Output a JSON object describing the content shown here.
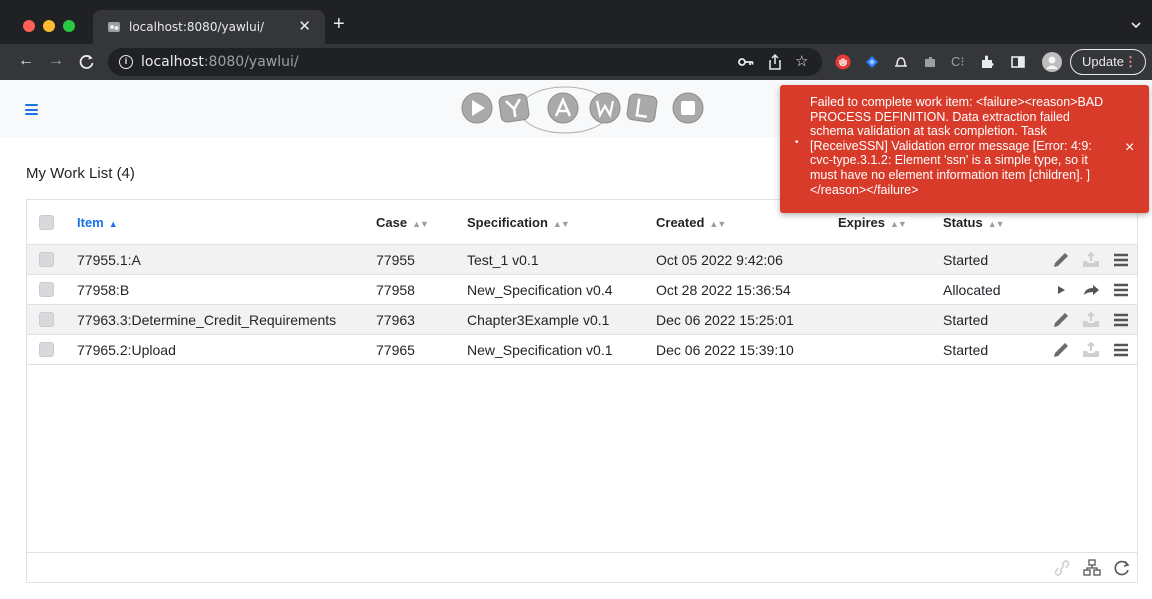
{
  "browser": {
    "tab_title": "localhost:8080/yawlui/",
    "url_host": "localhost",
    "url_rest": ":8080/yawlui/",
    "update_label": "Update"
  },
  "worklist": {
    "title": "My Work List (4)",
    "columns": [
      "Item",
      "Case",
      "Specification",
      "Created",
      "Expires",
      "Status"
    ],
    "sort_column": "Item",
    "rows": [
      {
        "item": "77955.1:A",
        "case": "77955",
        "spec": "Test_1 v0.1",
        "created": "Oct 05 2022 9:42:06",
        "expires": "",
        "status": "Started"
      },
      {
        "item": "77958:B",
        "case": "77958",
        "spec": "New_Specification v0.4",
        "created": "Oct 28 2022 15:36:54",
        "expires": "",
        "status": "Allocated"
      },
      {
        "item": "77963.3:Determine_Credit_Requirements",
        "case": "77963",
        "spec": "Chapter3Example v0.1",
        "created": "Dec 06 2022 15:25:01",
        "expires": "",
        "status": "Started"
      },
      {
        "item": "77965.2:Upload",
        "case": "77965",
        "spec": "New_Specification v0.1",
        "created": "Dec 06 2022 15:39:10",
        "expires": "",
        "status": "Started"
      }
    ]
  },
  "toast": {
    "message": "Failed to complete work item: <failure><reason>BAD PROCESS DEFINITION. Data extraction failed schema validation at task completion. Task [ReceiveSSN] Validation error message [Error: 4:9: cvc-type.3.1.2: Element 'ssn' is a simple type, so it must have no element information item [children]. ]</reason></failure>",
    "close": "×",
    "bullet": "•"
  },
  "icons": {
    "edit": "pencil-icon",
    "upload": "upload-icon",
    "menu": "list-menu-icon",
    "start": "play-icon",
    "forward": "forward-arrow-icon",
    "link": "link-icon",
    "hierarchy": "hierarchy-icon",
    "refresh": "refresh-icon"
  },
  "colors": {
    "accent": "#1a73e8",
    "toast_bg": "#d93b2b",
    "row_alt": "#f2f2f2"
  }
}
